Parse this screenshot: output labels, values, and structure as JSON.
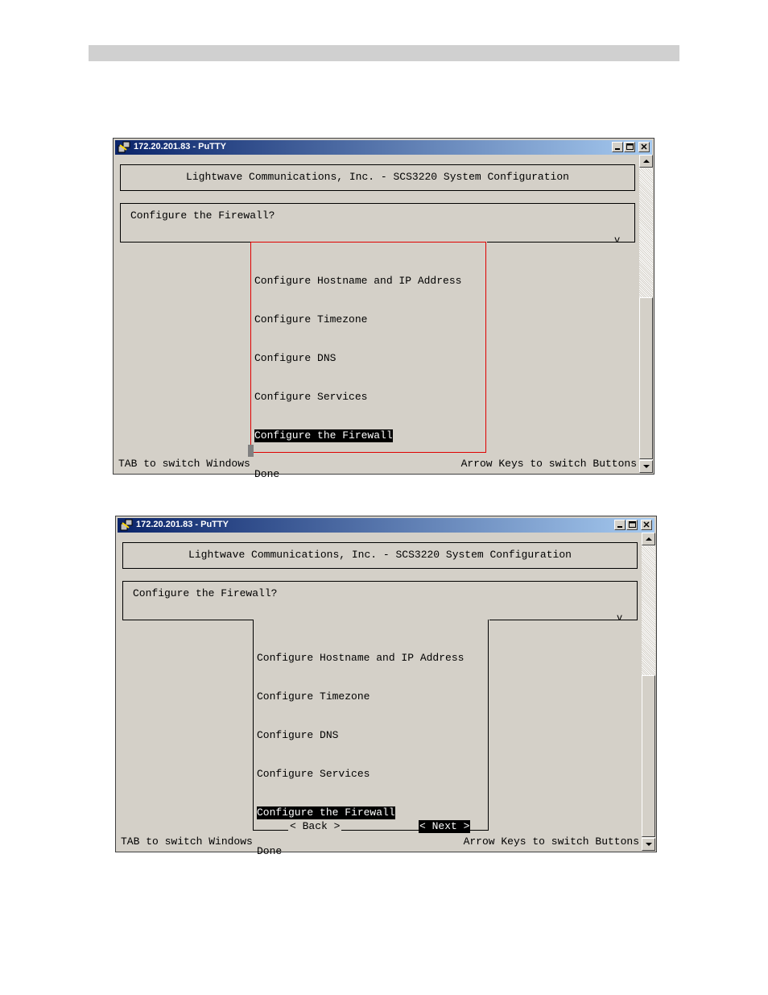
{
  "window_title": "172.20.201.83 - PuTTY",
  "header": "Lightwave Communications, Inc. - SCS3220 System Configuration",
  "question": "Configure the Firewall?",
  "menu_items": [
    "Configure Hostname and IP Address",
    "Configure Timezone",
    "Configure DNS",
    "Configure Services",
    "Configure the Firewall",
    "Done"
  ],
  "selected_index": 4,
  "buttons": {
    "back": "< Back >",
    "next": "< Next >"
  },
  "status": {
    "left": "TAB to switch Windows",
    "right": "Arrow Keys to switch Buttons"
  },
  "colors": {
    "titlebar": "#0a246a",
    "highlight": "#000000",
    "focus_border": "#e00000",
    "terminal_bg": "#d4d0c8"
  }
}
